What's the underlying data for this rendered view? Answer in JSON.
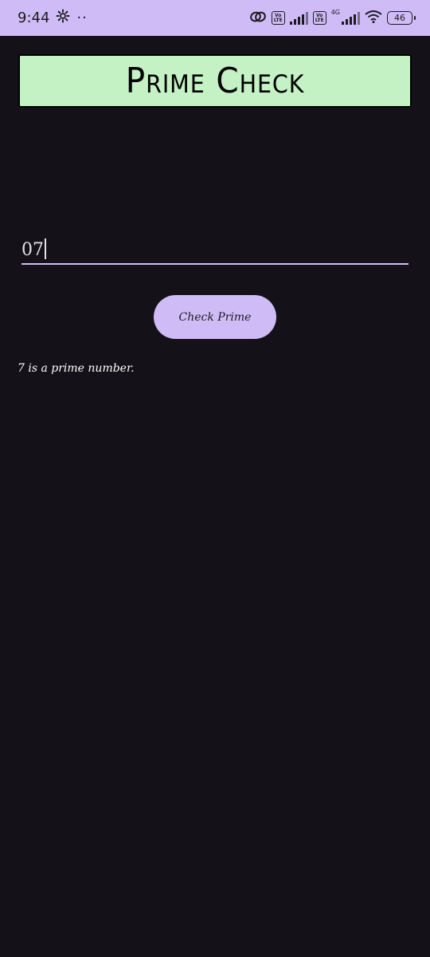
{
  "status_bar": {
    "time": "9:44",
    "dots": "··",
    "volte_label_1": "Vo",
    "volte_label_2": "LTE",
    "network_type": "4G",
    "battery": "46",
    "icons": [
      "gear-icon",
      "link-icon",
      "signal-icon",
      "wifi-icon",
      "battery-icon"
    ]
  },
  "header": {
    "title": "Prime Check"
  },
  "input": {
    "value": "07"
  },
  "button": {
    "label": "Check Prime"
  },
  "result": {
    "text": "7 is a prime number."
  },
  "colors": {
    "background": "#141218",
    "status_bar": "#CFBCF7",
    "header_bg": "#C4F2C4",
    "button_bg": "#CFBCF7",
    "underline": "#CFBCF7",
    "text": "#FFFFFF"
  }
}
